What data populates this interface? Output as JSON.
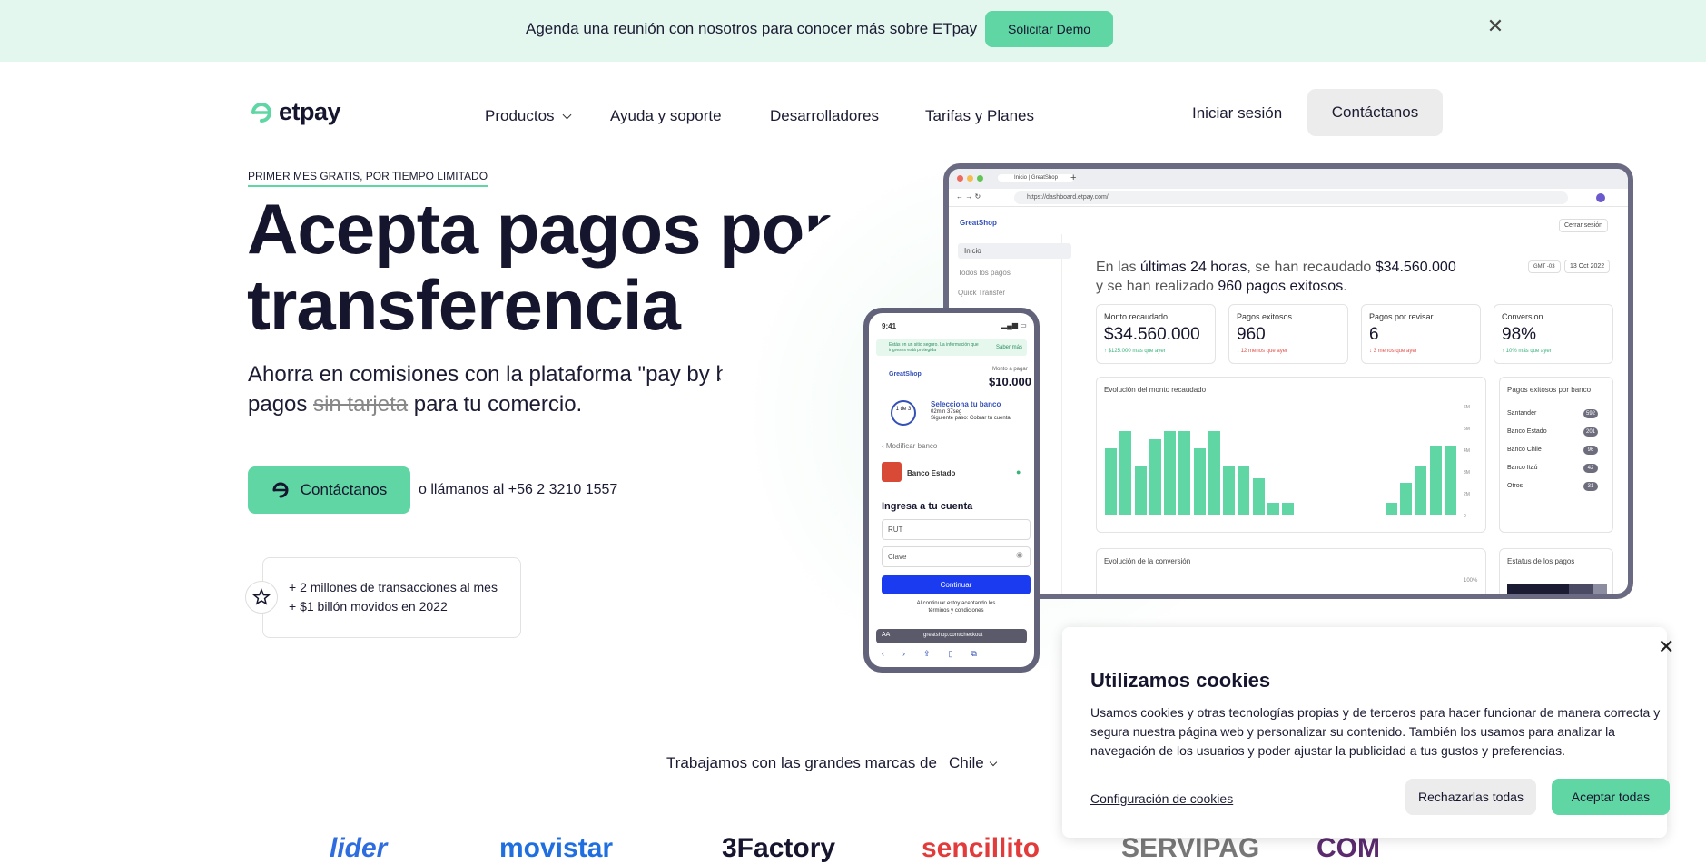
{
  "banner": {
    "text": "Agenda una reunión con nosotros para conocer más sobre ETpay",
    "demo_button": "Solicitar Demo",
    "close_icon": "close-icon"
  },
  "nav": {
    "logo_text": "etpay",
    "items": [
      "Productos",
      "Ayuda y soporte",
      "Desarrolladores",
      "Tarifas y Planes"
    ],
    "login": "Iniciar sesión",
    "contact": "Contáctanos"
  },
  "hero": {
    "eyebrow": "PRIMER MES GRATIS, POR TIEMPO LIMITADO",
    "title_line1": "Acepta pagos por",
    "title_line2": "transferencia",
    "sub_pre": "Ahorra en comisiones con la plataforma \"pay by bank\" de pagos ",
    "sub_strike": "sin tarjeta",
    "sub_post": " para tu comercio.",
    "cta": "Contáctanos",
    "phone": "o llámanos al +56 2 3210 1557",
    "stat1": "+ 2 millones de transacciones al mes",
    "stat2": "+ $1 billón movidos en 2022"
  },
  "dashboard": {
    "tab_title": "Inicio | GreatShop",
    "url": "https://dashboard.etpay.com/",
    "brand": "GreatShop",
    "logout": "Cerrar sesión",
    "side_items": [
      "Inicio",
      "Todos los pagos",
      "Quick Transfer"
    ],
    "summary_pre": "En las ",
    "summary_b1": "últimas 24 horas",
    "summary_mid": ", se han recaudado ",
    "summary_b2": "$34.560.000",
    "summary_line2_pre": "y se han realizado ",
    "summary_b3": "960 pagos exitosos",
    "summary_end": ".",
    "tz": "GMT -03",
    "date": "13 Oct 2022",
    "kpis": [
      {
        "label": "Monto recaudado",
        "value": "$34.560.000",
        "delta": "↑ $125.000 más que ayer"
      },
      {
        "label": "Pagos exitosos",
        "value": "960",
        "delta": "↓ 12 menos que ayer"
      },
      {
        "label": "Pagos por revisar",
        "value": "6",
        "delta": "↓ 3 menos que ayer"
      },
      {
        "label": "Conversion",
        "value": "98%",
        "delta": "↑ 10% más que ayer"
      }
    ],
    "chart_title": "Evolución del monto recaudado",
    "bars": [
      0.62,
      0.78,
      0.46,
      0.7,
      0.78,
      0.78,
      0.62,
      0.78,
      0.46,
      0.46,
      0.34,
      0.11,
      0.11,
      0,
      0,
      0,
      0,
      0,
      0,
      0.11,
      0.3,
      0.46,
      0.64,
      0.64
    ],
    "y_ticks": [
      "6M",
      "5M",
      "4M",
      "3M",
      "2M",
      "0"
    ],
    "banks_title": "Pagos exitosos por banco",
    "banks": [
      {
        "name": "Santander",
        "count": "592"
      },
      {
        "name": "Banco Estado",
        "count": "201"
      },
      {
        "name": "Banco Chile",
        "count": "96"
      },
      {
        "name": "Banco Itaú",
        "count": "42"
      },
      {
        "name": "Otros",
        "count": "31"
      }
    ],
    "conv_title": "Evolución de la conversión",
    "conv_tick": "100%",
    "status_title": "Estatus de los pagos"
  },
  "phone": {
    "time": "9:41",
    "secure": "Estás en un sitio seguro. La información que ingreses está protegida",
    "more": "Saber más",
    "merchant": "GreatShop",
    "amount_label": "Monto a pagar",
    "amount": "$10.000",
    "step_title": "Selecciona tu banco",
    "step_sub": "02min 37seg",
    "step_next": "Siguiente paso: Cobrar tu cuenta",
    "step": "1 de 3",
    "change_bank": "Modificar banco",
    "bank": "Banco Estado",
    "login_title": "Ingresa a tu cuenta",
    "rut": "RUT",
    "pass": "Clave",
    "continue": "Continuar",
    "terms": "Al continuar estoy aceptando los términos y condiciones",
    "url": "greatshop.com/checkout"
  },
  "brands": {
    "text": "Trabajamos con las grandes marcas de",
    "country": "Chile",
    "logos": [
      "lider",
      "movistar",
      "3Factory",
      "sencillito",
      "SERVIPAG",
      "COM"
    ]
  },
  "cookies": {
    "title": "Utilizamos cookies",
    "body": "Usamos cookies y otras tecnologías propias y de terceros para hacer funcionar de manera correcta y segura nuestra página web y personalizar su contenido. También los usamos para analizar la navegación de los usuarios y poder ajustar la publicidad a tus gustos y preferencias.",
    "config": "Configuración de cookies",
    "reject": "Rechazarlas todas",
    "accept": "Aceptar todas"
  }
}
